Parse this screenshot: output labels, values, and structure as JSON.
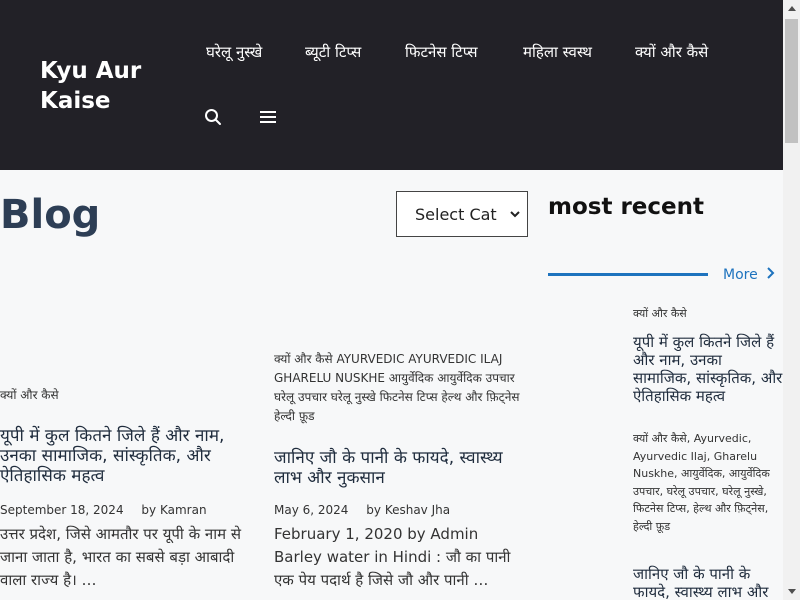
{
  "header": {
    "site_title": "Kyu Aur Kaise",
    "nav": [
      {
        "label": "घरेलू नुस्खे"
      },
      {
        "label": "ब्यूटी टिप्स"
      },
      {
        "label": "फिटनेस टिप्स"
      },
      {
        "label": "महिला स्वस्थ"
      },
      {
        "label": "क्यों और कैसे"
      }
    ],
    "icons": {
      "search": "search-icon",
      "menu": "menu-icon"
    }
  },
  "main": {
    "title": "Blog",
    "category_select": {
      "selected": "Select Cat"
    },
    "posts": [
      {
        "category": "क्यों और कैसे",
        "title": "यूपी में कुल कितने जिले हैं और नाम, उनका सामाजिक, सांस्कृतिक, और ऐतिहासिक महत्व",
        "date": "September 18, 2024",
        "author": "Kamran",
        "excerpt": "उत्तर प्रदेश, जिसे आमतौर पर यूपी के नाम से जाना जाता है, भारत का सबसे बड़ा आबादी वाला राज्य है। …"
      },
      {
        "category": "क्यों और कैसे AYURVEDIC AYURVEDIC ILAJ GHARELU NUSKHE आयुर्वेदिक आयुर्वेदिक उपचार घरेलू उपचार घरेलू नुस्खे फिटनेस टिप्स हेल्थ और फ़िट्नेस हेल्दी फ़ूड",
        "title": "जानिए जौ के पानी के फायदे, स्वास्थ्य लाभ और नुकसान",
        "date": "May 6, 2024",
        "author": "Keshav Jha",
        "excerpt": "February 1, 2020 by Admin Barley water in Hindi : जौ का पानी एक पेय पदार्थ है जिसे जौ और पानी …"
      }
    ]
  },
  "sidebar": {
    "widget_title": "most recent",
    "more_label": "More",
    "items": [
      {
        "category": "क्यों और कैसे",
        "title": "यूपी में कुल कितने जिले हैं और नाम, उनका सामाजिक, सांस्कृतिक, और ऐतिहासिक महत्व"
      },
      {
        "category": "क्यों और कैसे, Ayurvedic, Ayurvedic Ilaj, Gharelu Nuskhe, आयुर्वेदिक, आयुर्वेदिक उपचार, घरेलू उपचार, घरेलू नुस्खे, फिटनेस टिप्स, हेल्थ और फ़िट्नेस, हेल्दी फ़ूड",
        "title": "जानिए जौ के पानी के फायदे, स्वास्थ्य लाभ और नुकसान"
      }
    ]
  },
  "colors": {
    "header_bg": "#222127",
    "accent": "#1e73be",
    "title": "#2d3e55"
  }
}
